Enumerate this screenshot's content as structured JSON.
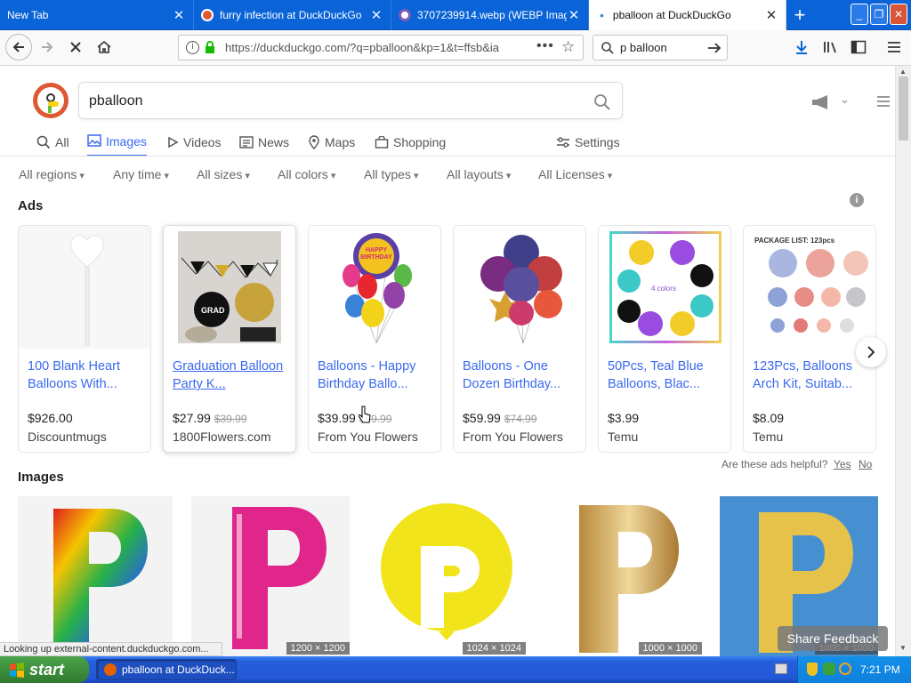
{
  "tabs": [
    {
      "title": "New Tab"
    },
    {
      "title": "furry infection at DuckDuckGo"
    },
    {
      "title": "3707239914.webp (WEBP Image..."
    },
    {
      "title": "pballoon at DuckDuckGo"
    }
  ],
  "nav": {
    "url": "https://duckduckgo.com/?q=pballoon&kp=1&t=ffsb&ia",
    "search_value": "p balloon"
  },
  "ddg": {
    "query": "pballoon",
    "tabs": [
      "All",
      "Images",
      "Videos",
      "News",
      "Maps",
      "Shopping"
    ],
    "settings_label": "Settings",
    "filters": [
      "All regions",
      "Any time",
      "All sizes",
      "All colors",
      "All types",
      "All layouts",
      "All Licenses"
    ],
    "ads_label": "Ads",
    "images_label": "Images",
    "helpful_q": "Are these ads helpful?",
    "yes": "Yes",
    "no": "No",
    "share_feedback": "Share Feedback"
  },
  "ads": [
    {
      "title": "100 Blank Heart Balloons With...",
      "price": "$926.00",
      "old": "",
      "seller": "Discountmugs"
    },
    {
      "title": "Graduation Balloon Party K...",
      "price": "$27.99",
      "old": "$39.99",
      "seller": "1800Flowers.com"
    },
    {
      "title": "Balloons - Happy Birthday Ballo...",
      "price": "$39.99",
      "old": "$49.99",
      "seller": "From You Flowers"
    },
    {
      "title": "Balloons - One Dozen Birthday...",
      "price": "$59.99",
      "old": "$74.99",
      "seller": "From You Flowers"
    },
    {
      "title": "50Pcs, Teal Blue Balloons, Blac...",
      "price": "$3.99",
      "old": "",
      "seller": "Temu"
    },
    {
      "title": "123Pcs, Balloons Arch Kit, Suitab...",
      "price": "$8.09",
      "old": "",
      "seller": "Temu"
    }
  ],
  "ad_image_text": {
    "grad": "GRAD",
    "birthday": "HAPPY BIRTHDAY",
    "colors": "4 colors",
    "package": "PACKAGE LIST: 123pcs"
  },
  "results": [
    {
      "dim": ""
    },
    {
      "dim": "1200 × 1200"
    },
    {
      "dim": "1024 × 1024"
    },
    {
      "dim": "1000 × 1000"
    },
    {
      "dim": "1000 × 1000"
    }
  ],
  "status": "Looking up external-content.duckduckgo.com...",
  "taskbar": {
    "start": "start",
    "task": "pballoon at DuckDuck...",
    "time": "7:21 PM"
  },
  "colors": {
    "ddg_blue": "#3969ef",
    "xp_blue": "#245edb",
    "firefox_blue": "#0a64d8",
    "ddg_orange": "#de5833"
  }
}
